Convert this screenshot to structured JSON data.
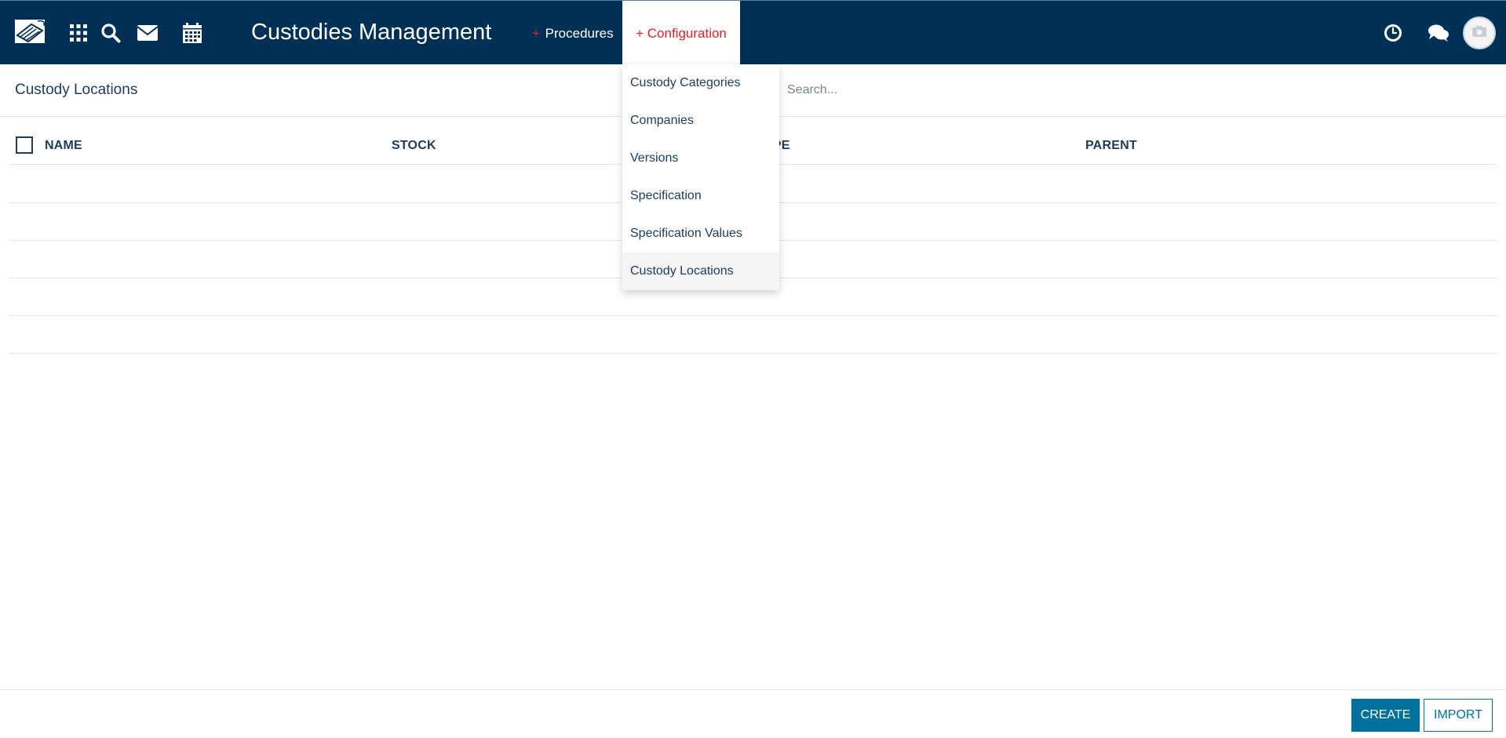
{
  "header": {
    "app_title": "Custodies Management",
    "icons": [
      "app-logo",
      "apps-grid-icon",
      "search-icon",
      "mail-icon",
      "calendar-icon",
      "clock-icon",
      "chat-icon",
      "camera-icon"
    ],
    "menus": {
      "procedures_plus": "+",
      "procedures_label": "Procedures",
      "configuration_label": "+ Configuration"
    }
  },
  "configuration_menu": {
    "items": [
      {
        "label": "Custody Categories"
      },
      {
        "label": "Companies"
      },
      {
        "label": "Versions"
      },
      {
        "label": "Specification"
      },
      {
        "label": "Specification Values"
      },
      {
        "label": "Custody Locations"
      }
    ]
  },
  "control_panel": {
    "breadcrumb": "Custody Locations",
    "search_placeholder": "Search..."
  },
  "table": {
    "columns": [
      "NAME",
      "STOCK",
      "TYPE",
      "PARENT"
    ]
  },
  "buttons": {
    "create": "CREATE",
    "import": "IMPORT"
  },
  "colors": {
    "navbar": "#003056",
    "accent_red": "#e31e24",
    "primary_button": "#00719c",
    "text": "#1f3a5a"
  }
}
